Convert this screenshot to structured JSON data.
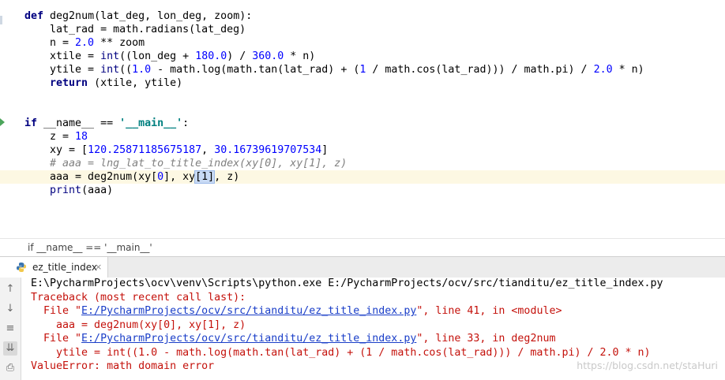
{
  "editor": {
    "lines": {
      "l1": {
        "kw": "def",
        "rest": " deg2num(lat_deg, lon_deg, zoom):"
      },
      "l2": {
        "text": "    lat_rad = math.radians(lat_deg)"
      },
      "l3": {
        "a": "    n = ",
        "n1": "2.0",
        "b": " ** zoom"
      },
      "l4": {
        "a": "    xtile = ",
        "bi": "int",
        "b": "((lon_deg + ",
        "n1": "180.0",
        "c": ") / ",
        "n2": "360.0",
        "d": " * n)"
      },
      "l5": {
        "a": "    ytile = ",
        "bi": "int",
        "b": "((",
        "n1": "1.0",
        "c": " - math.log(math.tan(lat_rad) + (",
        "n2": "1",
        "d": " / math.cos(lat_rad))) / math.pi) / ",
        "n3": "2.0",
        "e": " * n)"
      },
      "l6": {
        "a": "    ",
        "kw": "return",
        "b": " (xtile, ytile)"
      },
      "l7": {
        "kw": "if",
        "a": " __name__ == ",
        "str": "'__main__'",
        "b": ":"
      },
      "l8": {
        "a": "    z = ",
        "n1": "18"
      },
      "l9": {
        "a": "    xy = [",
        "n1": "120.25871185675187",
        "b": ", ",
        "n2": "30.16739619707534",
        "c": "]"
      },
      "l10": {
        "text": "    # aaa = lng_lat_to_title_index(xy[0], xy[1], z)"
      },
      "l11": {
        "a": "    aaa = deg2num(xy[",
        "n1": "0",
        "b": "], xy",
        "sel": "[1]",
        "c": ", z)"
      },
      "l12": {
        "a": "    ",
        "bi": "print",
        "b": "(aaa)"
      }
    }
  },
  "breadcrumb": "if __name__ == '__main__'",
  "run_tab": {
    "label": "ez_title_index",
    "close": "×"
  },
  "tools": {
    "up": "↑",
    "down": "↓",
    "wrap": "≡",
    "scroll": "⇊",
    "print": "⎙"
  },
  "console": {
    "cmd": "E:\\PycharmProjects\\ocv\\venv\\Scripts\\python.exe E:/PycharmProjects/ocv/src/tianditu/ez_title_index.py",
    "traceback": "Traceback (most recent call last):",
    "f1_a": "  File \"",
    "f1_link": "E:/PycharmProjects/ocv/src/tianditu/ez_title_index.py",
    "f1_b": "\", line 41, in <module>",
    "f1_code": "    aaa = deg2num(xy[0], xy[1], z)",
    "f2_a": "  File \"",
    "f2_link": "E:/PycharmProjects/ocv/src/tianditu/ez_title_index.py",
    "f2_b": "\", line 33, in deg2num",
    "f2_code": "    ytile = int((1.0 - math.log(math.tan(lat_rad) + (1 / math.cos(lat_rad))) / math.pi) / 2.0 * n)",
    "error": "ValueError: math domain error"
  },
  "watermark": "https://blog.csdn.net/staHuri",
  "colors": {
    "keyword": "#000080",
    "number": "#0000ff",
    "string": "#008080",
    "comment": "#808080",
    "error": "#c4110b",
    "link": "#1a3ec8",
    "caret_line": "#fdf8e3"
  }
}
